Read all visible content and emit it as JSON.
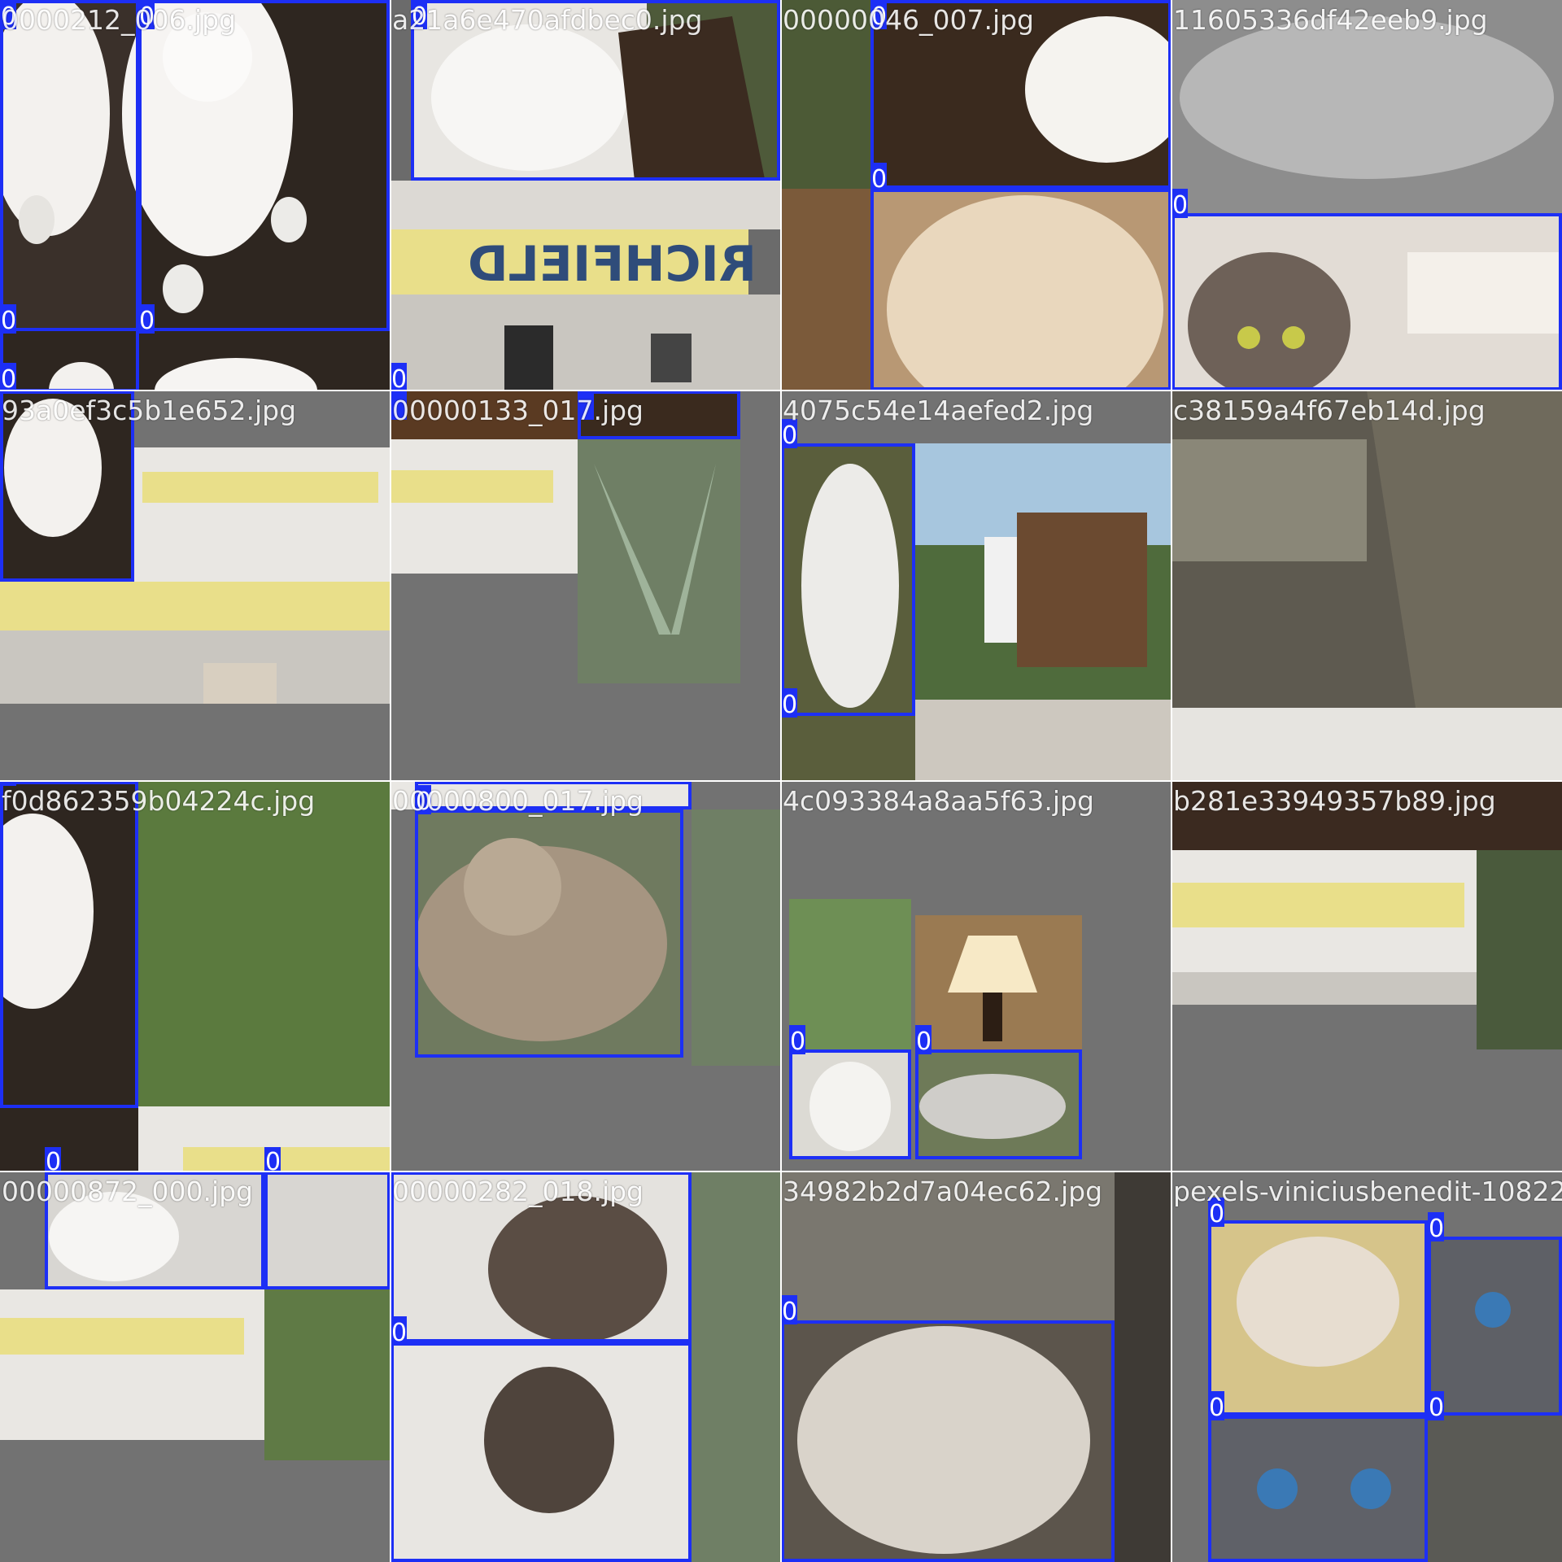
{
  "mosaic": {
    "box_color": "#1d2ff5",
    "tiles": [
      {
        "name": "0000212_006.jpg",
        "labels": [
          "0",
          "0",
          "0",
          "0",
          "0"
        ]
      },
      {
        "name": "a21a6e470afdbec0.jpg",
        "labels": [
          "0",
          "0"
        ]
      },
      {
        "name": "00000046_007.jpg",
        "labels": [
          "0",
          "0"
        ]
      },
      {
        "name": "11605336df42eeb9.jpg",
        "labels": [
          "0"
        ]
      },
      {
        "name": "93a0ef3c5b1e652.jpg",
        "labels": []
      },
      {
        "name": "00000133_017.jpg",
        "labels": []
      },
      {
        "name": "4075c54e14aefed2.jpg",
        "labels": [
          "0",
          "0"
        ]
      },
      {
        "name": "c38159a4f67eb14d.jpg",
        "labels": []
      },
      {
        "name": "f0d862359b04224c.jpg",
        "labels": [
          "0",
          "0",
          "0",
          "0"
        ]
      },
      {
        "name": "00000800_017.jpg",
        "labels": [
          "0",
          "0",
          "0"
        ]
      },
      {
        "name": "4c093384a8aa5f63.jpg",
        "labels": [
          "0",
          "0"
        ]
      },
      {
        "name": "b281e33949357b89.jpg",
        "labels": []
      },
      {
        "name": "00000872_000.jpg",
        "labels": []
      },
      {
        "name": "00000282_018.jpg",
        "labels": [
          "0"
        ]
      },
      {
        "name": "34982b2d7a04ec62.jpg",
        "labels": [
          "0"
        ]
      },
      {
        "name": "pexels-viniciusbenedit-10822",
        "labels": [
          "0",
          "0",
          "0",
          "0"
        ]
      }
    ]
  }
}
